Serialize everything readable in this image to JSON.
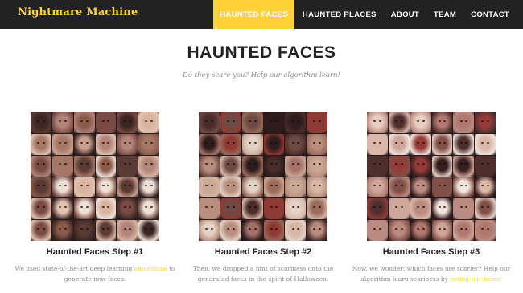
{
  "brand": "Nightmare Machine",
  "nav": [
    {
      "label": "Haunted Faces",
      "active": true
    },
    {
      "label": "Haunted Places",
      "active": false
    },
    {
      "label": "About",
      "active": false
    },
    {
      "label": "Team",
      "active": false
    },
    {
      "label": "Contact",
      "active": false
    }
  ],
  "hero": {
    "title": "HAUNTED FACES",
    "subtitle": "Do they scare you? Help our algorithm learn!"
  },
  "colors": {
    "navbar": "#222222",
    "accent": "#fed136",
    "text_dark": "#222222",
    "text_muted": "#8a8a8a"
  },
  "cards": [
    {
      "title": "Haunted Faces Step #1",
      "desc_before": "We used state-of-the-art deep learning ",
      "link": "algorithms",
      "desc_after": " to generate new faces.",
      "image": "collage of ai-generated faces"
    },
    {
      "title": "Haunted Faces Step #2",
      "desc_before": "Then, we dropped a hint of scariness onto the generated faces in the spirit of Halloween.",
      "link": "",
      "desc_after": "",
      "image": "collage of haunted ai-generated faces"
    },
    {
      "title": "Haunted Faces Step #3",
      "desc_before": "Now, we wonder: which faces are scarier? Help our algorithm learn scariness by ",
      "link": "voting our faces!",
      "desc_after": "",
      "image": "collage of scary ai-generated faces"
    }
  ]
}
